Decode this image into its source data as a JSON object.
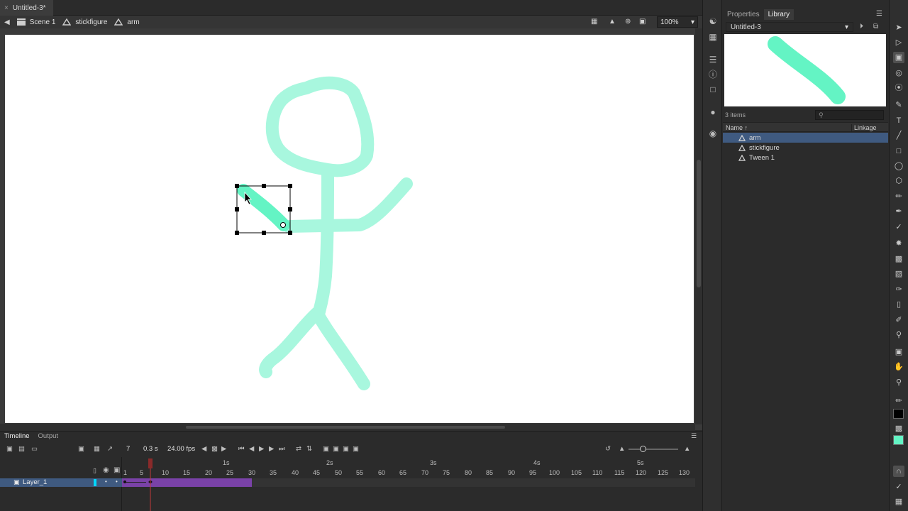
{
  "document_tab": {
    "title": "Untitled-3*",
    "close": "×"
  },
  "edit_bar": {
    "breadcrumbs": [
      {
        "label": "Scene 1",
        "icon": "clapper-icon"
      },
      {
        "label": "stickfigure",
        "icon": "symbol-icon"
      },
      {
        "label": "arm",
        "icon": "symbol-icon"
      }
    ],
    "zoom": "100%"
  },
  "panel": {
    "tabs": [
      "Properties",
      "Library"
    ],
    "active_tab": "Library",
    "library_doc": "Untitled-3",
    "item_count": "3 items",
    "columns": {
      "name": "Name",
      "linkage": "Linkage"
    },
    "items": [
      {
        "name": "arm",
        "selected": true
      },
      {
        "name": "stickfigure",
        "selected": false
      },
      {
        "name": "Tween 1",
        "selected": false
      }
    ]
  },
  "timeline": {
    "tabs": [
      "Timeline",
      "Output"
    ],
    "active_tab": "Timeline",
    "current_frame": "7",
    "time": "0.3 s",
    "fps": "24.00 fps",
    "layer_name": "Layer_1",
    "frame_ticks": [
      "1",
      "5",
      "10",
      "15",
      "20",
      "25",
      "30",
      "35",
      "40",
      "45",
      "50",
      "55",
      "60",
      "65",
      "70",
      "75",
      "80",
      "85",
      "90",
      "95",
      "100",
      "105",
      "110",
      "115",
      "120",
      "125",
      "130"
    ],
    "second_labels": [
      "1s",
      "2s",
      "3s",
      "4s",
      "5s"
    ]
  },
  "colors": {
    "stroke": "#000000",
    "fill": "#64f4c4",
    "figure": "#a8f7de",
    "selection_blue": "#3f5a80",
    "tween_purple": "#7a42a8"
  }
}
